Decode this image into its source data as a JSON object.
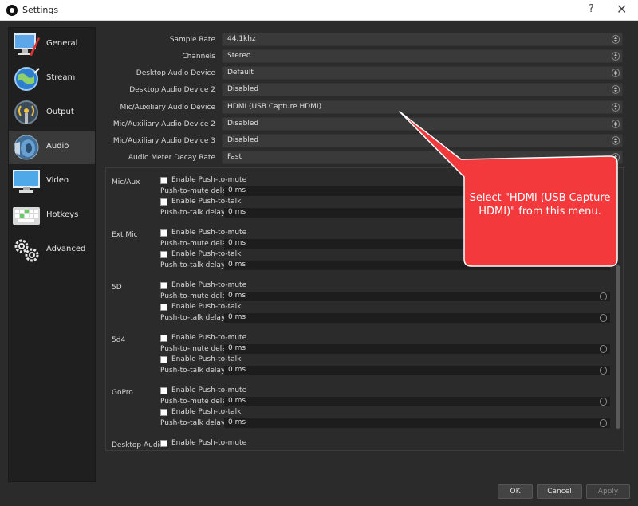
{
  "window": {
    "title": "Settings",
    "help_glyph": "?",
    "close_glyph": "✕"
  },
  "sidebar": {
    "items": [
      {
        "label": "General"
      },
      {
        "label": "Stream"
      },
      {
        "label": "Output"
      },
      {
        "label": "Audio"
      },
      {
        "label": "Video"
      },
      {
        "label": "Hotkeys"
      },
      {
        "label": "Advanced"
      }
    ],
    "active": "Audio"
  },
  "settings": [
    {
      "label": "Sample Rate",
      "value": "44.1khz"
    },
    {
      "label": "Channels",
      "value": "Stereo"
    },
    {
      "label": "Desktop Audio Device",
      "value": "Default"
    },
    {
      "label": "Desktop Audio Device 2",
      "value": "Disabled"
    },
    {
      "label": "Mic/Auxiliary Audio Device",
      "value": "HDMI (USB Capture HDMI)"
    },
    {
      "label": "Mic/Auxiliary Audio Device 2",
      "value": "Disabled"
    },
    {
      "label": "Mic/Auxiliary Audio Device 3",
      "value": "Disabled"
    },
    {
      "label": "Audio Meter Decay Rate",
      "value": "Fast"
    }
  ],
  "hotkeys": {
    "enable_ptm": "Enable Push-to-mute",
    "ptm_delay": "Push-to-mute delay",
    "enable_ptt": "Enable Push-to-talk",
    "ptt_delay": "Push-to-talk delay",
    "devices": [
      {
        "name": "Mic/Aux",
        "ptm_delay": "0 ms",
        "ptt_delay": "0 ms"
      },
      {
        "name": "Ext Mic",
        "ptm_delay": "0 ms",
        "ptt_delay": "0 ms"
      },
      {
        "name": "5D",
        "ptm_delay": "0 ms",
        "ptt_delay": "0 ms"
      },
      {
        "name": "5d4",
        "ptm_delay": "0 ms",
        "ptt_delay": "0 ms"
      },
      {
        "name": "GoPro",
        "ptm_delay": "0 ms",
        "ptt_delay": "0 ms"
      },
      {
        "name": "Desktop Audio"
      }
    ]
  },
  "buttons": {
    "ok": "OK",
    "cancel": "Cancel",
    "apply": "Apply"
  },
  "callout": {
    "text": "Select \"HDMI (USB Capture HDMI)\" from this menu.",
    "color": "#f4393d"
  }
}
